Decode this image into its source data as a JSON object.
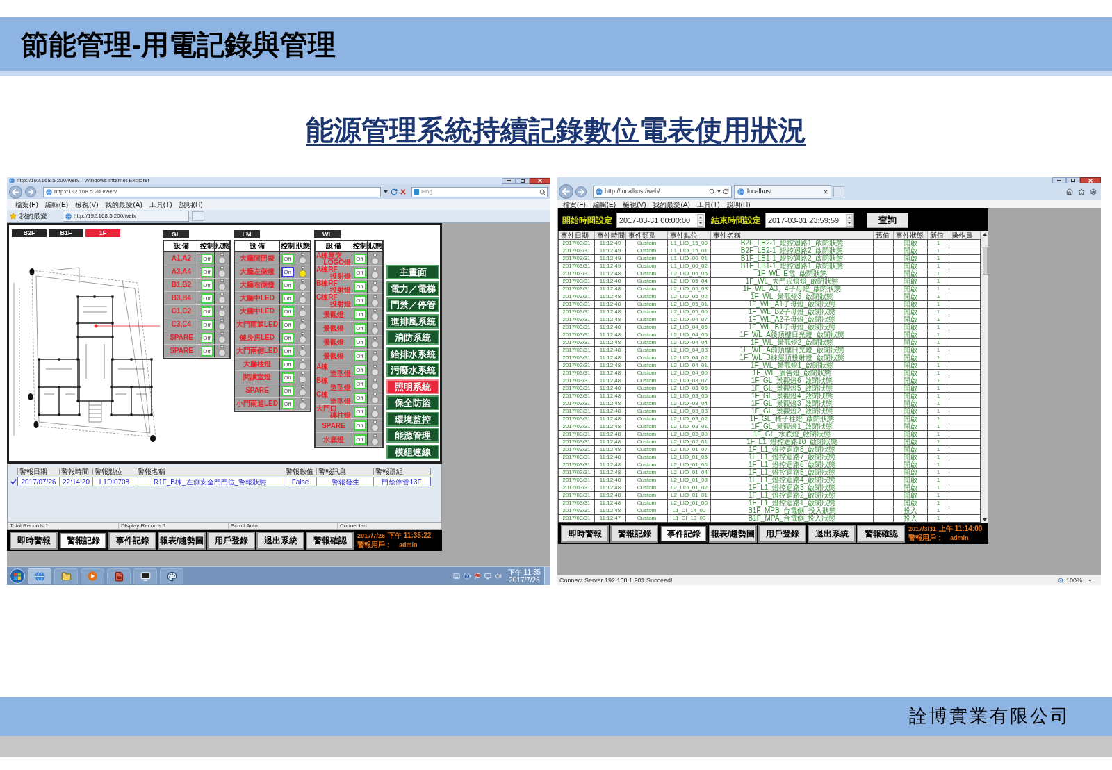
{
  "slide": {
    "title": "節能管理-用電記錄與管理",
    "subtitle": "能源管理系統持續記錄數位電表使用狀況",
    "company": "詮博實業有限公司"
  },
  "left_window": {
    "title": "http://192.168.5.200/web/ - Windows Internet Explorer",
    "address": "http://192.168.5.200/web/",
    "search": {
      "placeholder": "Bing"
    },
    "menu": [
      "檔案(F)",
      "編輯(E)",
      "檢視(V)",
      "我的最愛(A)",
      "工具(T)",
      "說明(H)"
    ],
    "favorites": "我的最愛",
    "tab": "http://192.168.5.200/web/",
    "floors": [
      {
        "label": "B2F",
        "selected": false
      },
      {
        "label": "B1F",
        "selected": false
      },
      {
        "label": "1F",
        "selected": true
      }
    ],
    "panels": [
      {
        "title": "GL",
        "columns": [
          "設 備",
          "控制",
          "狀態"
        ],
        "devices": [
          {
            "lines": [
              "A1,A2"
            ],
            "control": "Off",
            "on": false
          },
          {
            "lines": [
              "A3,A4"
            ],
            "control": "Off",
            "on": false
          },
          {
            "lines": [
              "B1,B2"
            ],
            "control": "Off",
            "on": false
          },
          {
            "lines": [
              "B3,B4"
            ],
            "control": "Off",
            "on": false
          },
          {
            "lines": [
              "C1,C2"
            ],
            "control": "Off",
            "on": false
          },
          {
            "lines": [
              "C3,C4"
            ],
            "control": "Off",
            "on": false
          },
          {
            "lines": [
              "SPARE"
            ],
            "control": "Off",
            "on": false
          },
          {
            "lines": [
              "SPARE"
            ],
            "control": "Off",
            "on": false
          }
        ]
      },
      {
        "title": "LM",
        "columns": [
          "設 備",
          "控制",
          "狀態"
        ],
        "devices": [
          {
            "lines": [
              "大廳間照燈"
            ],
            "control": "Off",
            "on": false
          },
          {
            "lines": [
              "大廳左側燈"
            ],
            "control": "On",
            "on": true
          },
          {
            "lines": [
              "大廳右側燈"
            ],
            "control": "Off",
            "on": false
          },
          {
            "lines": [
              "大廳中LED"
            ],
            "control": "Off",
            "on": false
          },
          {
            "lines": [
              "大廳中LED"
            ],
            "control": "Off",
            "on": false
          },
          {
            "lines": [
              "大門雨遮LED"
            ],
            "control": "Off",
            "on": false
          },
          {
            "lines": [
              "健身房LED"
            ],
            "control": "Off",
            "on": false
          },
          {
            "lines": [
              "大門兩側LED"
            ],
            "control": "Off",
            "on": false
          },
          {
            "lines": [
              "大廳柱燈"
            ],
            "control": "Off",
            "on": false
          },
          {
            "lines": [
              "閱讀室燈"
            ],
            "control": "Off",
            "on": false
          },
          {
            "lines": [
              "SPARE"
            ],
            "control": "Off",
            "on": false
          },
          {
            "lines": [
              "小門雨遮LED"
            ],
            "control": "Off",
            "on": false
          }
        ]
      },
      {
        "title": "WL",
        "columns": [
          "設 備",
          "控制",
          "狀態"
        ],
        "devices": [
          {
            "lines": [
              "A棟屋突",
              "LOGO燈"
            ],
            "control": "Off",
            "on": false
          },
          {
            "lines": [
              "A棟RF",
              "投射燈"
            ],
            "control": "Off",
            "on": false
          },
          {
            "lines": [
              "B棟RF",
              "投射燈"
            ],
            "control": "Off",
            "on": false
          },
          {
            "lines": [
              "C棟RF",
              "投射燈"
            ],
            "control": "Off",
            "on": false
          },
          {
            "lines": [
              "景觀燈"
            ],
            "control": "Off",
            "on": false
          },
          {
            "lines": [
              "景觀燈"
            ],
            "control": "Off",
            "on": false
          },
          {
            "lines": [
              "景觀燈"
            ],
            "control": "Off",
            "on": false
          },
          {
            "lines": [
              "景觀燈"
            ],
            "control": "Off",
            "on": false
          },
          {
            "lines": [
              "A棟",
              "造型燈"
            ],
            "control": "Off",
            "on": false
          },
          {
            "lines": [
              "B棟",
              "造型燈"
            ],
            "control": "Off",
            "on": false
          },
          {
            "lines": [
              "C棟",
              "造型燈"
            ],
            "control": "Off",
            "on": false
          },
          {
            "lines": [
              "大門口",
              "磚柱燈"
            ],
            "control": "Off",
            "on": false
          },
          {
            "lines": [
              "SPARE"
            ],
            "control": "Off",
            "on": false
          },
          {
            "lines": [
              "水底燈"
            ],
            "control": "Off",
            "on": false
          }
        ]
      }
    ],
    "nav": [
      {
        "label": "主畫面",
        "selected": false
      },
      {
        "label": "電力／電梯",
        "selected": false
      },
      {
        "label": "門禁／停管",
        "selected": false
      },
      {
        "label": "進排風系統",
        "selected": false
      },
      {
        "label": "消防系統",
        "selected": false
      },
      {
        "label": "給排水系統",
        "selected": false
      },
      {
        "label": "污廢水系統",
        "selected": false
      },
      {
        "label": "照明系統",
        "selected": true
      },
      {
        "label": "保全防盜",
        "selected": false
      },
      {
        "label": "環境監控",
        "selected": false
      },
      {
        "label": "能源管理",
        "selected": false
      },
      {
        "label": "模組連線",
        "selected": false
      }
    ],
    "alarms": {
      "columns": [
        "警報日期",
        "警報時間",
        "警報點位",
        "警報名稱",
        "警報數值",
        "警報訊息",
        "警報群組"
      ],
      "rows": [
        {
          "checked": true,
          "cells": [
            "2017/07/26",
            "22:14:20",
            "L1DI0708",
            "R1F_B棟_左側安全門門位_警報狀態",
            "False",
            "警報發生",
            "門禁停管13F"
          ]
        }
      ]
    },
    "status_bar": [
      "Total Records:1",
      "Display Records:1",
      "Scroll:Auto",
      "Connected"
    ],
    "buttons": [
      {
        "label": "即時警報",
        "selected": false
      },
      {
        "label": "警報記錄",
        "selected": true
      },
      {
        "label": "事件記錄",
        "selected": false
      },
      {
        "label": "報表/趨勢圖",
        "selected": false
      },
      {
        "label": "用戶登錄",
        "selected": false
      },
      {
        "label": "退出系統",
        "selected": false
      },
      {
        "label": "警報確認",
        "selected": false
      }
    ],
    "clock": {
      "date": "2017/7/26",
      "time": "下午 11:35:22",
      "user_label": "警報用戶：",
      "user": "admin"
    },
    "taskbar": {
      "time": "下午 11:35",
      "date": "2017/7/26"
    }
  },
  "right_window": {
    "address": "http://localhost/web/",
    "tab": "localhost",
    "menu": [
      "檔案(F)",
      "編輯(E)",
      "檢視(V)",
      "我的最愛(A)",
      "工具(T)",
      "說明(H)"
    ],
    "query": {
      "start_label": "開始時間設定",
      "start_value": "2017-03-31 00:00:00",
      "end_label": "結束時間設定",
      "end_value": "2017-03-31 23:59:59",
      "button": "查詢"
    },
    "events": {
      "columns": [
        "事件日期",
        "事件時間",
        "事件類型",
        "事件點位",
        "事件名稱",
        "舊值",
        "事件狀態",
        "新值",
        "操作員"
      ],
      "rows": [
        {
          "date": "2017/03/31",
          "time": "11:12:49",
          "type": "Custom",
          "point": "L1_LIO_15_00",
          "name": "B2F_LB2-1_燈控迴路1_啟閉狀態",
          "status": "開啟",
          "new_value": "1"
        },
        {
          "date": "2017/03/31",
          "time": "11:12:49",
          "type": "Custom",
          "point": "L1_LIO_15_01",
          "name": "B2F_LB2-1_燈控迴路2_啟閉狀態",
          "status": "開啟",
          "new_value": "1"
        },
        {
          "date": "2017/03/31",
          "time": "11:12:49",
          "type": "Custom",
          "point": "L1_LIO_00_01",
          "name": "B1F_LB1-1_燈控迴路2_啟閉狀態",
          "status": "開啟",
          "new_value": "1"
        },
        {
          "date": "2017/03/31",
          "time": "11:12:49",
          "type": "Custom",
          "point": "L1_LIO_00_02",
          "name": "B1F_LB1-1_燈控迴路1_啟閉狀態",
          "status": "開啟",
          "new_value": "1"
        },
        {
          "date": "2017/03/31",
          "time": "11:12:48",
          "type": "Custom",
          "point": "L2_LIO_05_05",
          "name": "1F_WL_E電_啟閉狀態",
          "status": "開啟",
          "new_value": "1"
        },
        {
          "date": "2017/03/31",
          "time": "11:12:48",
          "type": "Custom",
          "point": "L2_LIO_05_04",
          "name": "1F_WL_大門崁燈燈_啟閉狀態",
          "status": "開啟",
          "new_value": "1"
        },
        {
          "date": "2017/03/31",
          "time": "11:12:48",
          "type": "Custom",
          "point": "L2_LIO_05_03",
          "name": "1F_WL_A3、4子母燈_啟閉狀態",
          "status": "開啟",
          "new_value": "1"
        },
        {
          "date": "2017/03/31",
          "time": "11:12:48",
          "type": "Custom",
          "point": "L2_LIO_05_02",
          "name": "1F_WL_景觀燈3_啟閉狀態",
          "status": "開啟",
          "new_value": "1"
        },
        {
          "date": "2017/03/31",
          "time": "11:12:48",
          "type": "Custom",
          "point": "L2_LIO_05_01",
          "name": "1F_WL_A1子母燈_啟閉狀態",
          "status": "開啟",
          "new_value": "1"
        },
        {
          "date": "2017/03/31",
          "time": "11:12:48",
          "type": "Custom",
          "point": "L2_LIO_05_00",
          "name": "1F_WL_B2子母燈_啟閉狀態",
          "status": "開啟",
          "new_value": "1"
        },
        {
          "date": "2017/03/31",
          "time": "11:12:48",
          "type": "Custom",
          "point": "L2_LIO_04_07",
          "name": "1F_WL_A2子母燈_啟閉狀態",
          "status": "開啟",
          "new_value": "1"
        },
        {
          "date": "2017/03/31",
          "time": "11:12:48",
          "type": "Custom",
          "point": "L2_LIO_04_06",
          "name": "1F_WL_B1子母燈_啟閉狀態",
          "status": "開啟",
          "new_value": "1"
        },
        {
          "date": "2017/03/31",
          "time": "11:12:48",
          "type": "Custom",
          "point": "L2_LIO_04_05",
          "name": "1F_WL_A後頂樓日光燈_啟閉狀態",
          "status": "開啟",
          "new_value": "1"
        },
        {
          "date": "2017/03/31",
          "time": "11:12:48",
          "type": "Custom",
          "point": "L2_LIO_04_04",
          "name": "1F_WL_景觀燈2_啟閉狀態",
          "status": "開啟",
          "new_value": "1"
        },
        {
          "date": "2017/03/31",
          "time": "11:12:48",
          "type": "Custom",
          "point": "L2_LIO_04_03",
          "name": "1F_WL_A前頂樓日光燈_啟閉狀態",
          "status": "開啟",
          "new_value": "1"
        },
        {
          "date": "2017/03/31",
          "time": "11:12:48",
          "type": "Custom",
          "point": "L2_LIO_04_02",
          "name": "1F_WL_B棟屋頂投射燈_啟閉狀態",
          "status": "開啟",
          "new_value": "1"
        },
        {
          "date": "2017/03/31",
          "time": "11:12:48",
          "type": "Custom",
          "point": "L2_LIO_04_01",
          "name": "1F_WL_景觀燈1_啟閉狀態",
          "status": "開啟",
          "new_value": "1"
        },
        {
          "date": "2017/03/31",
          "time": "11:12:48",
          "type": "Custom",
          "point": "L2_LIO_04_00",
          "name": "1F_WL_廣告燈_啟閉狀態",
          "status": "開啟",
          "new_value": "1"
        },
        {
          "date": "2017/03/31",
          "time": "11:12:48",
          "type": "Custom",
          "point": "L2_LIO_03_07",
          "name": "1F_GL_景觀燈6_啟閉狀態",
          "status": "開啟",
          "new_value": "1"
        },
        {
          "date": "2017/03/31",
          "time": "11:12:48",
          "type": "Custom",
          "point": "L2_LIO_03_06",
          "name": "1F_GL_景觀燈5_啟閉狀態",
          "status": "開啟",
          "new_value": "1"
        },
        {
          "date": "2017/03/31",
          "time": "11:12:48",
          "type": "Custom",
          "point": "L2_LIO_03_05",
          "name": "1F_GL_景觀燈4_啟閉狀態",
          "status": "開啟",
          "new_value": "1"
        },
        {
          "date": "2017/03/31",
          "time": "11:12:48",
          "type": "Custom",
          "point": "L2_LIO_03_04",
          "name": "1F_GL_景觀燈3_啟閉狀態",
          "status": "開啟",
          "new_value": "1"
        },
        {
          "date": "2017/03/31",
          "time": "11:12:48",
          "type": "Custom",
          "point": "L2_LIO_03_03",
          "name": "1F_GL_景觀燈2_啟閉狀態",
          "status": "開啟",
          "new_value": "1"
        },
        {
          "date": "2017/03/31",
          "time": "11:12:48",
          "type": "Custom",
          "point": "L2_LIO_03_02",
          "name": "1F_GL_椅子柱燈_啟閉狀態",
          "status": "開啟",
          "new_value": "1"
        },
        {
          "date": "2017/03/31",
          "time": "11:12:48",
          "type": "Custom",
          "point": "L2_LIO_03_01",
          "name": "1F_GL_景觀燈1_啟閉狀態",
          "status": "開啟",
          "new_value": "1"
        },
        {
          "date": "2017/03/31",
          "time": "11:12:48",
          "type": "Custom",
          "point": "L2_LIO_03_00",
          "name": "1F_GL_水底燈_啟閉狀態",
          "status": "開啟",
          "new_value": "1"
        },
        {
          "date": "2017/03/31",
          "time": "11:12:48",
          "type": "Custom",
          "point": "L2_LIO_02_01",
          "name": "1F_L1_燈控迴路10_啟閉狀態",
          "status": "開啟",
          "new_value": "1"
        },
        {
          "date": "2017/03/31",
          "time": "11:12:48",
          "type": "Custom",
          "point": "L2_LIO_01_07",
          "name": "1F_L1_燈控迴路8_啟閉狀態",
          "status": "開啟",
          "new_value": "1"
        },
        {
          "date": "2017/03/31",
          "time": "11:12:48",
          "type": "Custom",
          "point": "L2_LIO_01_06",
          "name": "1F_L1_燈控迴路7_啟閉狀態",
          "status": "開啟",
          "new_value": "1"
        },
        {
          "date": "2017/03/31",
          "time": "11:12:48",
          "type": "Custom",
          "point": "L2_LIO_01_05",
          "name": "1F_L1_燈控迴路6_啟閉狀態",
          "status": "開啟",
          "new_value": "1"
        },
        {
          "date": "2017/03/31",
          "time": "11:12:48",
          "type": "Custom",
          "point": "L2_LIO_01_04",
          "name": "1F_L1_燈控迴路5_啟閉狀態",
          "status": "開啟",
          "new_value": "1"
        },
        {
          "date": "2017/03/31",
          "time": "11:12:48",
          "type": "Custom",
          "point": "L2_LIO_01_03",
          "name": "1F_L1_燈控迴路4_啟閉狀態",
          "status": "開啟",
          "new_value": "1"
        },
        {
          "date": "2017/03/31",
          "time": "11:12:48",
          "type": "Custom",
          "point": "L2_LIO_01_02",
          "name": "1F_L1_燈控迴路3_啟閉狀態",
          "status": "開啟",
          "new_value": "1"
        },
        {
          "date": "2017/03/31",
          "time": "11:12:48",
          "type": "Custom",
          "point": "L2_LIO_01_01",
          "name": "1F_L1_燈控迴路2_啟閉狀態",
          "status": "開啟",
          "new_value": "1"
        },
        {
          "date": "2017/03/31",
          "time": "11:12:48",
          "type": "Custom",
          "point": "L2_LIO_01_00",
          "name": "1F_L1_燈控迴路1_啟閉狀態",
          "status": "開啟",
          "new_value": "1"
        },
        {
          "date": "2017/03/31",
          "time": "11:12:48",
          "type": "Custom",
          "point": "L1_DI_14_00",
          "name": "B1F_MPB_台電側_投入狀態",
          "status": "投入",
          "new_value": "1"
        },
        {
          "date": "2017/03/31",
          "time": "11:12:47",
          "type": "Custom",
          "point": "L1_DI_13_00",
          "name": "B1F_MPA_台電側_投入狀態",
          "status": "投入",
          "new_value": "1"
        }
      ]
    },
    "buttons": [
      {
        "label": "即時警報",
        "selected": false
      },
      {
        "label": "警報記錄",
        "selected": false
      },
      {
        "label": "事件記錄",
        "selected": true
      },
      {
        "label": "報表/趨勢圖",
        "selected": false
      },
      {
        "label": "用戶登錄",
        "selected": false
      },
      {
        "label": "退出系統",
        "selected": false
      },
      {
        "label": "警報確認",
        "selected": false
      }
    ],
    "clock": {
      "date": "2017/3/31",
      "time": "上午 11:14:00",
      "user_label": "警報用戶：",
      "user": "admin"
    },
    "status_text": "Connect Server 192.168.1.201 Succeed!",
    "zoom": "100%"
  }
}
